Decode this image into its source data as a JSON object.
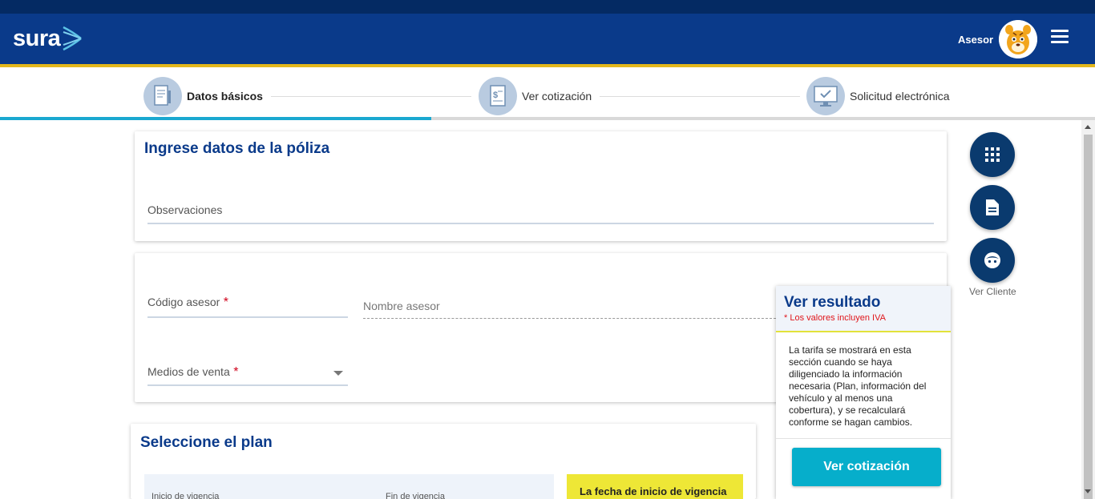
{
  "header": {
    "logo_text": "sura",
    "user_role": "Asesor",
    "colors": {
      "header_bg": "#0a3a8a",
      "accent_gold": "#e3b71c",
      "cyan": "#06aecb"
    }
  },
  "steps": [
    {
      "label": "Datos básicos",
      "icon": "document-edit-icon",
      "active": true
    },
    {
      "label": "Ver cotización",
      "icon": "invoice-dollar-icon",
      "active": false
    },
    {
      "label": "Solicitud electrónica",
      "icon": "monitor-icon",
      "active": false
    }
  ],
  "poliza_card": {
    "title": "Ingrese datos de la póliza",
    "observaciones_label": "Observaciones"
  },
  "asesor_card": {
    "codigo_label": "Código asesor",
    "nombre_label": "Nombre asesor",
    "medios_label": "Medios de venta",
    "required_mark": "*"
  },
  "plan_card": {
    "title": "Seleccione el plan",
    "inicio_label": "Inicio de vigencia",
    "fin_label": "Fin de vigencia",
    "notice_text": "La fecha de inicio de vigencia"
  },
  "side_actions": {
    "ver_cliente_label": "Ver Cliente"
  },
  "result_panel": {
    "title": "Ver resultado",
    "note": "* Los valores incluyen IVA",
    "body": "La tarifa se mostrará en esta sección cuando se haya diligenciado la información necesaria (Plan, información del vehículo y al menos una cobertura), y se recalculará conforme se hagan cambios.",
    "button_label": "Ver cotización"
  }
}
